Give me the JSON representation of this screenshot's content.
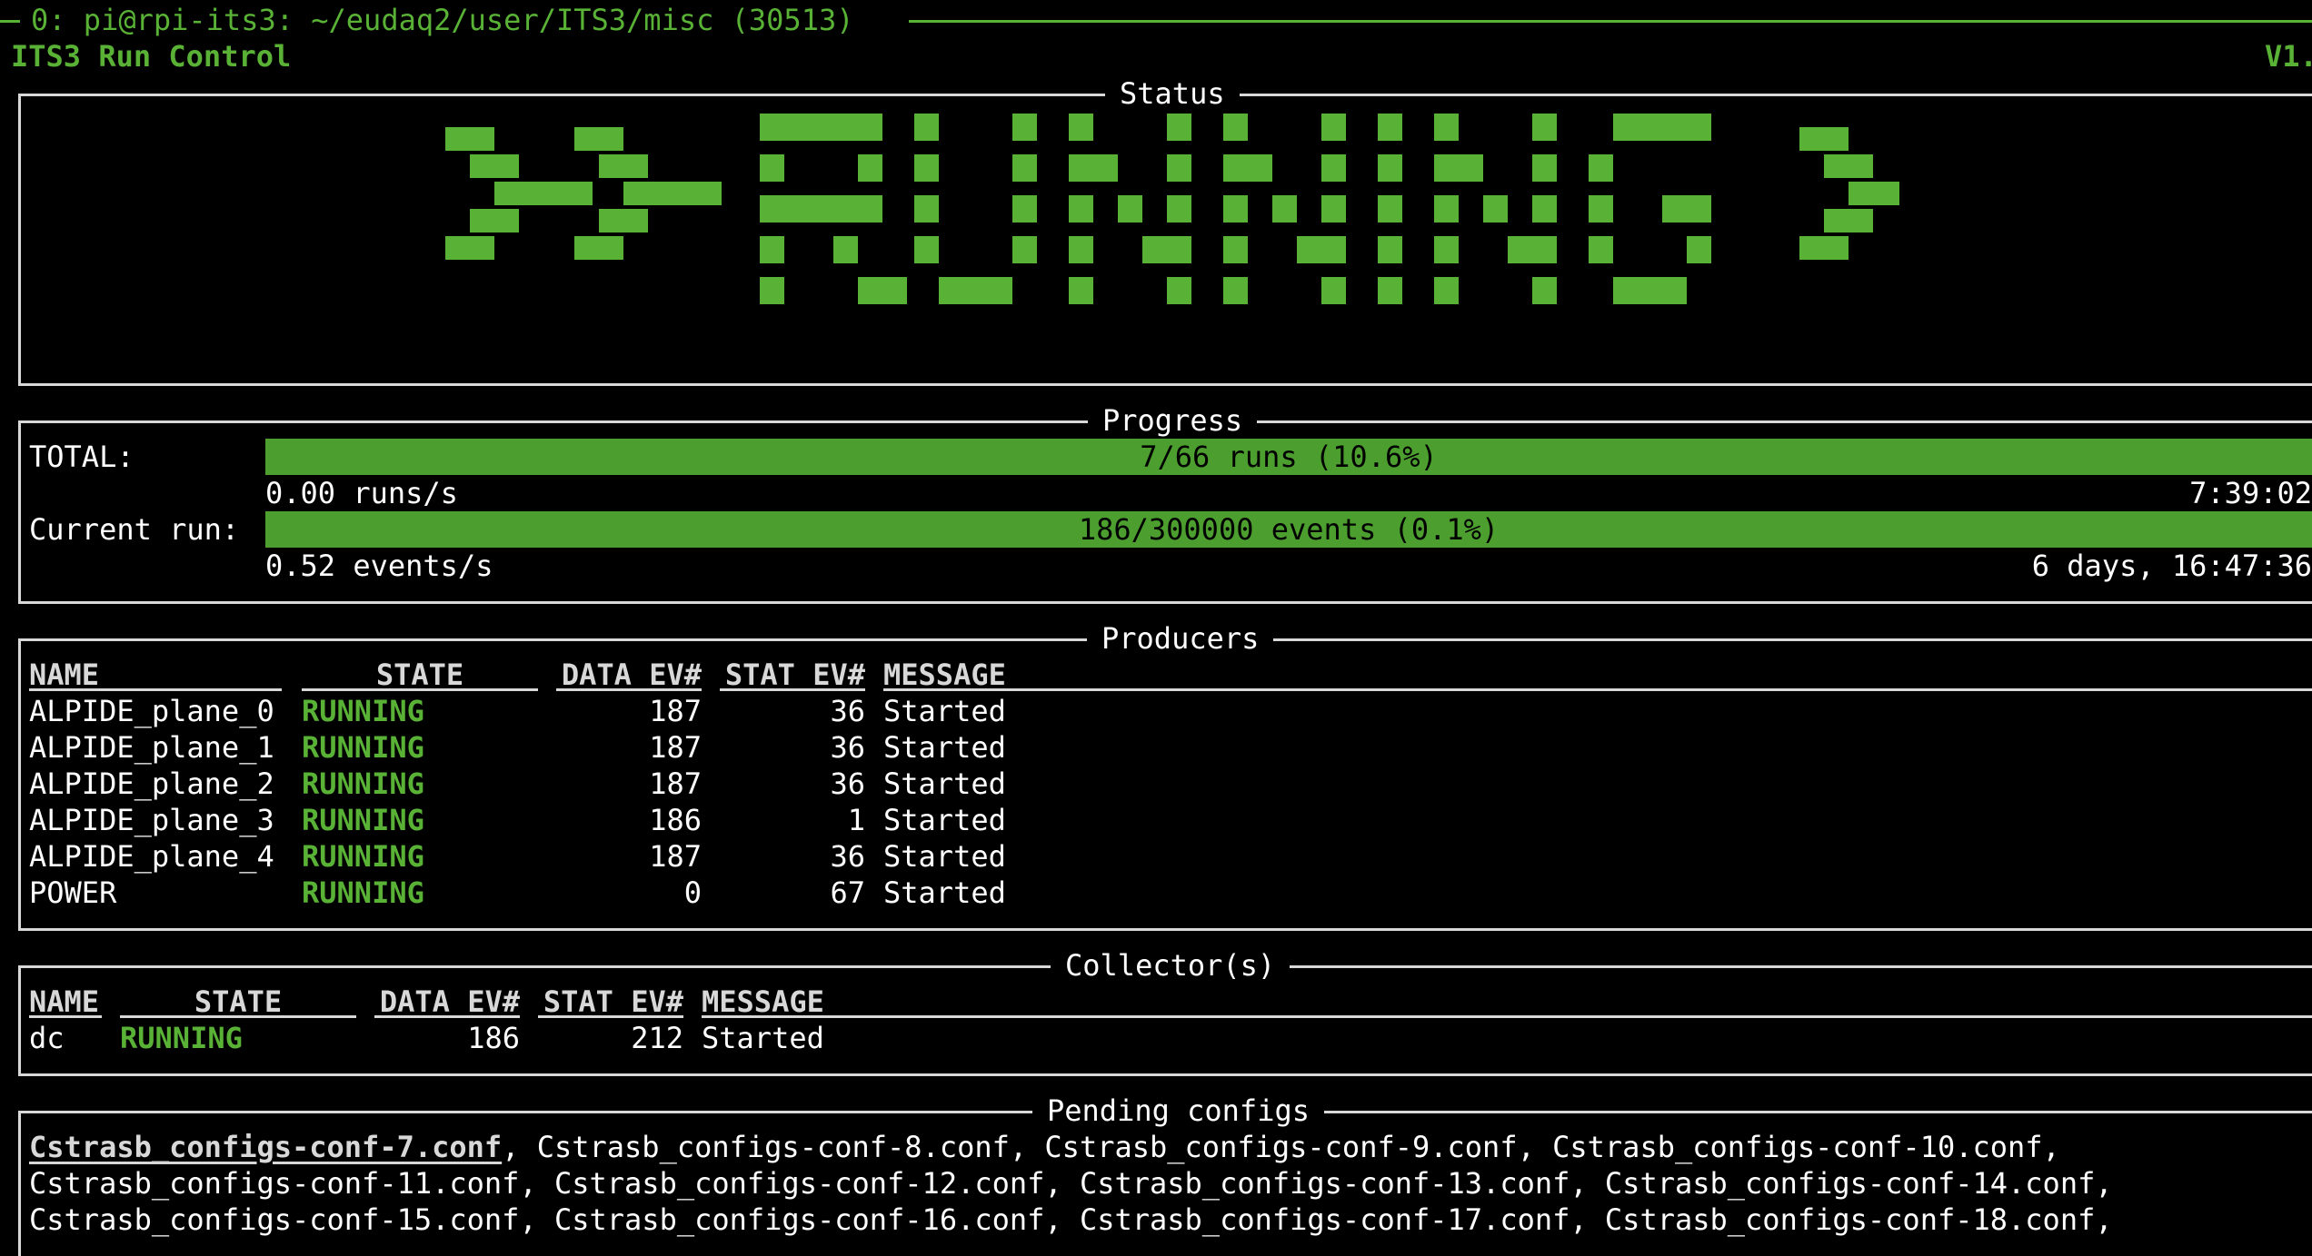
{
  "tmux": {
    "title": "0: pi@rpi-its3: ~/eudaq2/user/ITS3/misc (30513)"
  },
  "app": {
    "title": "ITS3 Run Control",
    "version": "V1."
  },
  "status": {
    "box_title": "Status",
    "state": "RUNNING",
    "arrow_left": ">>",
    "arrow_right": ">>"
  },
  "progress": {
    "box_title": "Progress",
    "total": {
      "label": "TOTAL:",
      "bar_text": "7/66 runs (10.6%)",
      "fraction": 0.106,
      "rate": "0.00 runs/s",
      "eta": "7:39:02"
    },
    "current": {
      "label": "Current run:",
      "bar_text": "186/300000 events (0.1%)",
      "fraction": 0.001,
      "rate": "0.52 events/s",
      "eta": "6 days, 16:47:36"
    }
  },
  "producers": {
    "box_title": "Producers",
    "headers": {
      "name": "NAME",
      "state": "STATE",
      "data": "DATA EV#",
      "stat": "STAT EV#",
      "message": "MESSAGE"
    },
    "rows": [
      {
        "name": "ALPIDE_plane_0",
        "state": "RUNNING",
        "data": "187",
        "stat": "36",
        "message": "Started"
      },
      {
        "name": "ALPIDE_plane_1",
        "state": "RUNNING",
        "data": "187",
        "stat": "36",
        "message": "Started"
      },
      {
        "name": "ALPIDE_plane_2",
        "state": "RUNNING",
        "data": "187",
        "stat": "36",
        "message": "Started"
      },
      {
        "name": "ALPIDE_plane_3",
        "state": "RUNNING",
        "data": "186",
        "stat": "1",
        "message": "Started"
      },
      {
        "name": "ALPIDE_plane_4",
        "state": "RUNNING",
        "data": "187",
        "stat": "36",
        "message": "Started"
      },
      {
        "name": "POWER",
        "state": "RUNNING",
        "data": "0",
        "stat": "67",
        "message": "Started"
      }
    ]
  },
  "collectors": {
    "box_title": "Collector(s)",
    "headers": {
      "name": "NAME",
      "state": "STATE",
      "data": "DATA EV#",
      "stat": "STAT EV#",
      "message": "MESSAGE"
    },
    "rows": [
      {
        "name": "dc",
        "state": "RUNNING",
        "data": "186",
        "stat": "212",
        "message": "Started"
      }
    ]
  },
  "pending": {
    "box_title": "Pending configs",
    "current": "Cstrasb_configs-conf-7.conf",
    "line1_rest": ", Cstrasb_configs-conf-8.conf, Cstrasb_configs-conf-9.conf, Cstrasb_configs-conf-10.conf,",
    "line2": "Cstrasb_configs-conf-11.conf, Cstrasb_configs-conf-12.conf, Cstrasb_configs-conf-13.conf, Cstrasb_configs-conf-14.conf,",
    "line3": "Cstrasb_configs-conf-15.conf, Cstrasb_configs-conf-16.conf, Cstrasb_configs-conf-17.conf, Cstrasb_configs-conf-18.conf,"
  },
  "colors": {
    "accent": "#59b236",
    "bar": "#4c9f2f",
    "background": "#000000",
    "text": "#ffffff",
    "border": "#d8d8d8"
  }
}
